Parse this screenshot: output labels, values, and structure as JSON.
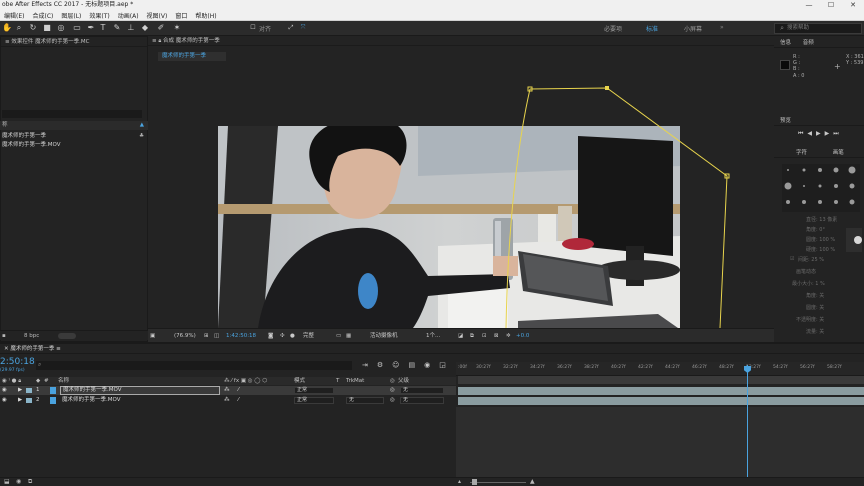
{
  "window": {
    "title": "obe After Effects CC 2017 - 无标题项目.aep *",
    "controls": [
      "—",
      "☐",
      "✕"
    ]
  },
  "menu": [
    "编辑(E)",
    "合成(C)",
    "图层(L)",
    "效果(T)",
    "动画(A)",
    "视图(V)",
    "窗口",
    "帮助(H)"
  ],
  "toolbar": {
    "align_label": "对齐",
    "workspaces": [
      "必要项",
      "标准",
      "小屏幕"
    ],
    "active_workspace": "标准",
    "search_placeholder": "搜索帮助"
  },
  "effect_controls": {
    "header": "效果控件 魔术师的手第一季.MC"
  },
  "project": {
    "list_header": "称",
    "items": [
      "魔术师的手第一季",
      "魔术师的手第一季.MOV"
    ],
    "bpc": "8 bpc"
  },
  "composition": {
    "header": "合成 魔术师的手第一季",
    "tab": "魔术师的手第一季",
    "zoom": "(76.9%)",
    "timecode": "1:42:50:18",
    "quality": "完整",
    "camera": "活动摄像机",
    "views": "1个...",
    "exposure": "+0.0"
  },
  "info_panel": {
    "tabs": [
      "信息",
      "音频"
    ],
    "rgba": [
      "R :",
      "G :",
      "B :",
      "A : 0"
    ],
    "coords": [
      "X : 361",
      "Y : 539"
    ]
  },
  "preview_panel": {
    "title": "预览"
  },
  "char_panel": {
    "tabs": [
      "字符",
      "画笔"
    ],
    "props": [
      "直径: 13 像素",
      "角度: 0°",
      "圆度: 100 %",
      "硬度: 100 %",
      "间距: 25 %",
      "画笔动态",
      "最小大小: 1 %",
      "角度: 关",
      "圆度: 关",
      "不透明度: 关",
      "流量: 关"
    ]
  },
  "timeline": {
    "comp_name": "魔术师的手第一季",
    "timecode": "2:50:18",
    "timecode_sub": "(29.97 fps)",
    "columns": {
      "name": "名称",
      "mode": "模式",
      "t": "T",
      "trkmat": "TrkMat",
      "parent": "父级"
    },
    "layers": [
      {
        "num": "1",
        "name": "魔术师的手第一季.MOV",
        "mode": "正常",
        "trkmat": "",
        "parent": "无"
      },
      {
        "num": "2",
        "name": "魔术师的手第一季.MOV",
        "mode": "正常",
        "trkmat": "无",
        "parent": "无"
      }
    ],
    "ruler_labels": [
      "30:27f",
      "32:27f",
      "34:27f",
      "36:27f",
      "38:27f",
      "40:27f",
      "42:27f",
      "44:27f",
      "46:27f",
      "48:27f",
      "53:27f",
      "54:27f",
      "56:27f",
      "58:27f"
    ]
  },
  "colors": {
    "accent": "#4aa3df",
    "mask_path": "#e8d44d",
    "track": "#8a9ca0"
  }
}
